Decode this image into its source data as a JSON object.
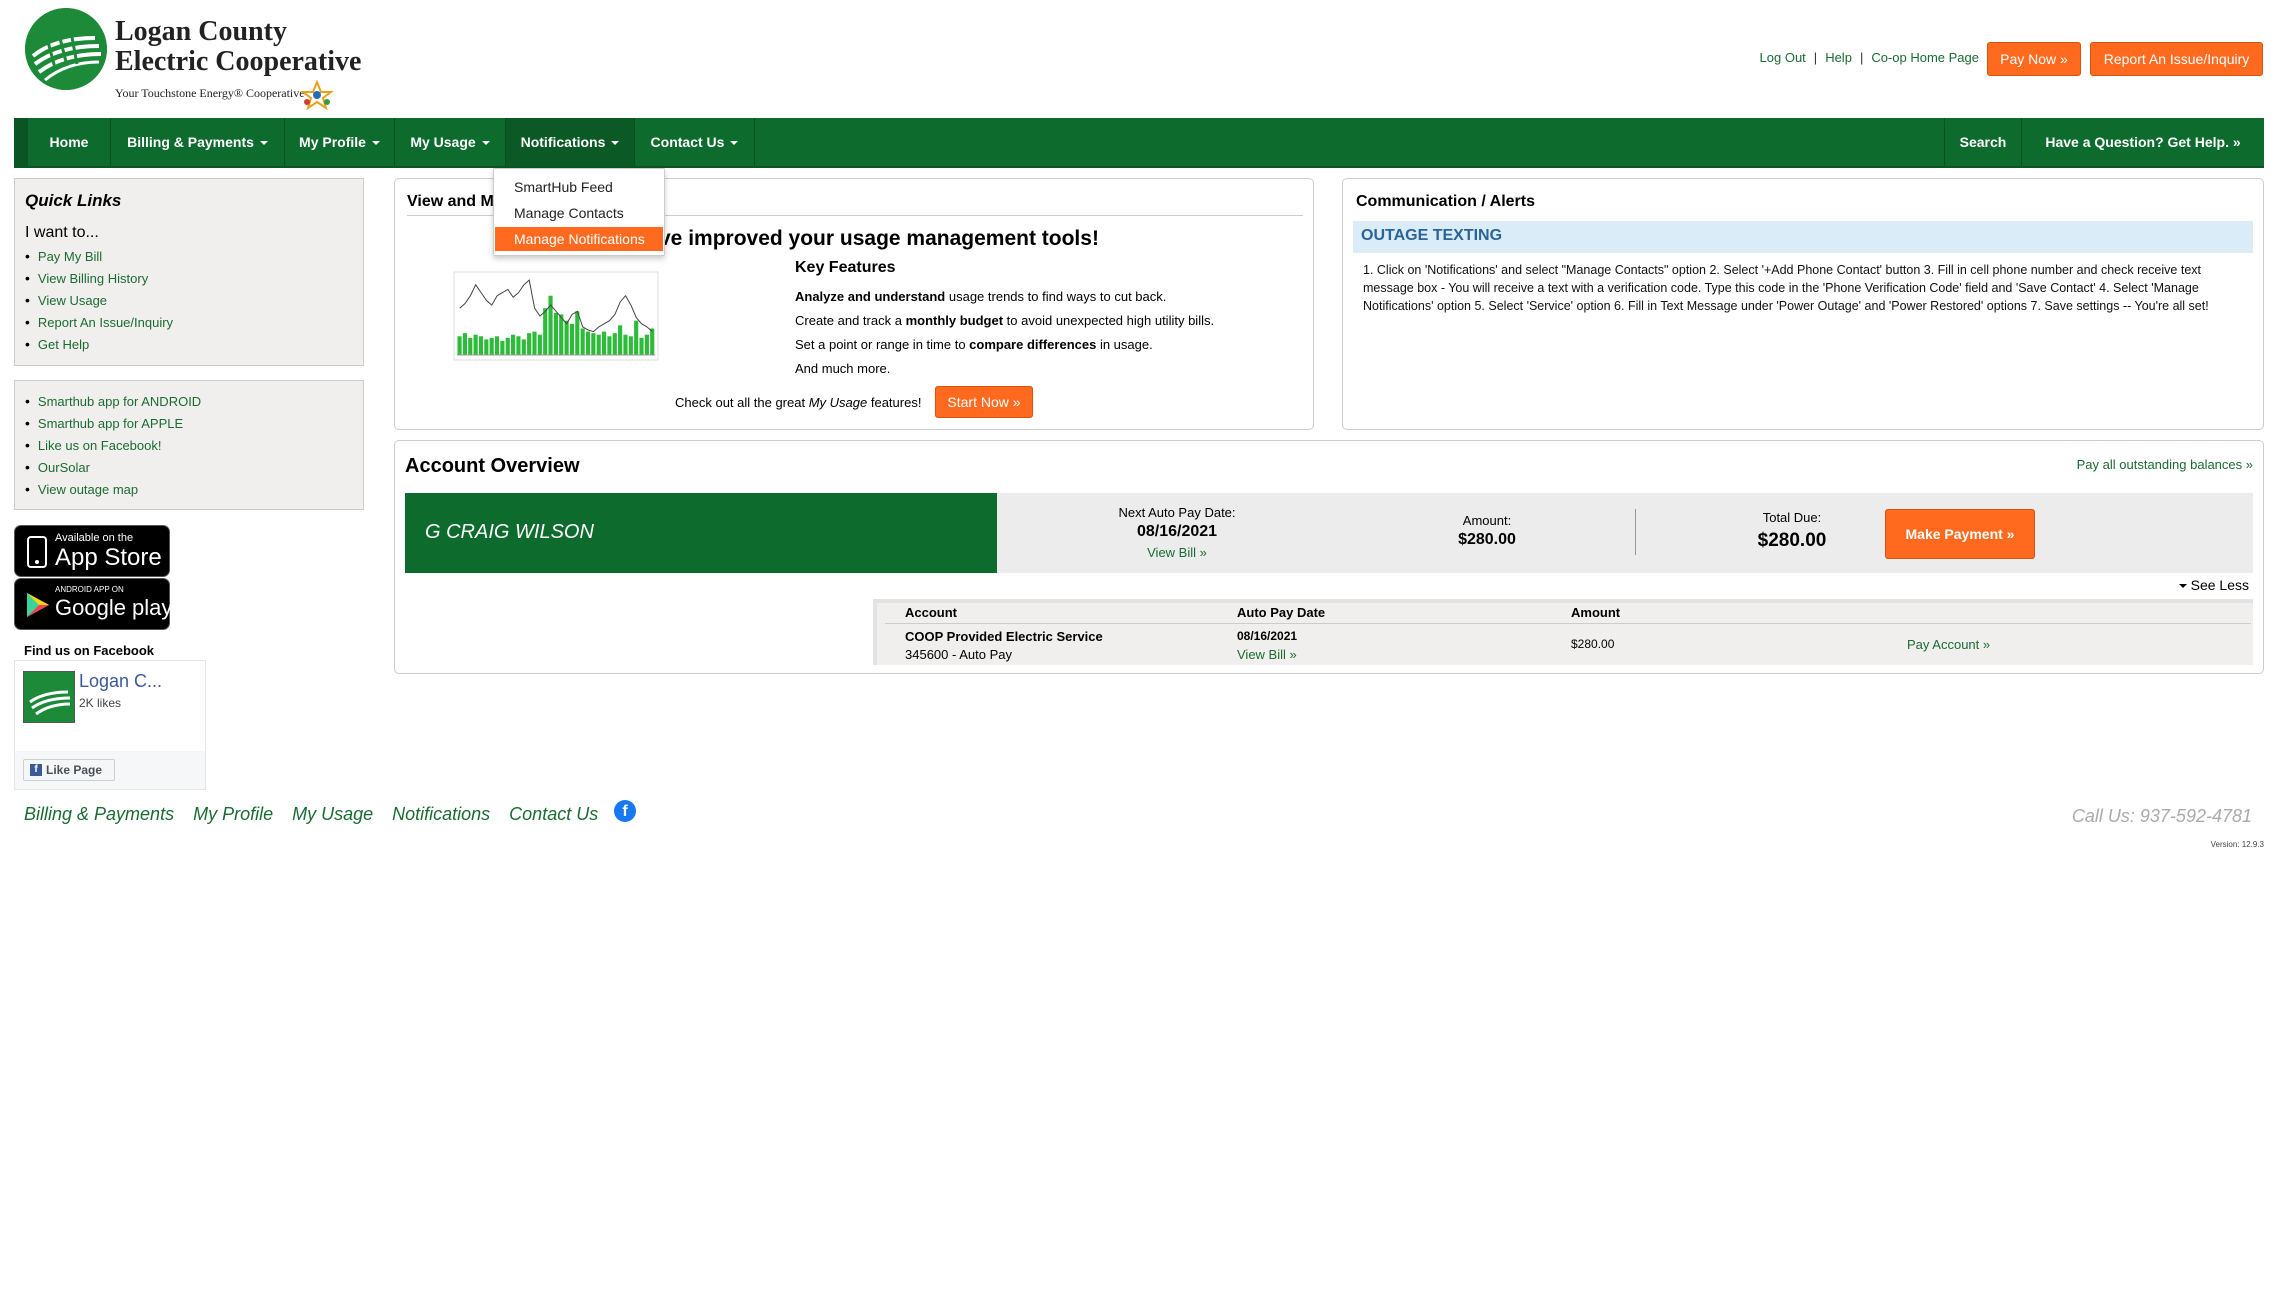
{
  "brand": {
    "name_line1": "Logan County",
    "name_line2": "Electric Cooperative",
    "tagline": "Your Touchstone Energy® Cooperative"
  },
  "header": {
    "links": [
      "Log Out",
      "Help",
      "Co-op Home Page"
    ],
    "pay_now": "Pay Now »",
    "report_issue": "Report An Issue/Inquiry"
  },
  "nav": {
    "items": [
      "Home",
      "Billing & Payments",
      "My Profile",
      "My Usage",
      "Notifications",
      "Contact Us"
    ],
    "search": "Search",
    "help": "Have a Question? Get Help. »"
  },
  "dropdown": {
    "items": [
      "SmartHub Feed",
      "Manage Contacts",
      "Manage Notifications"
    ],
    "selected": "Manage Notifications"
  },
  "quick_links": {
    "title": "Quick Links",
    "subtitle": "I want to...",
    "items": [
      "Pay My Bill",
      "View Billing History",
      "View Usage",
      "Report An Issue/Inquiry",
      "Get Help"
    ]
  },
  "app_links": {
    "items": [
      "Smarthub app for ANDROID",
      "Smarthub app for APPLE",
      "Like us on Facebook!",
      "OurSolar",
      "View outage map"
    ]
  },
  "badges": {
    "apple_small": "Available on the",
    "apple_big": "App Store",
    "google_small": "ANDROID APP ON",
    "google_big": "Google play"
  },
  "facebook": {
    "heading": "Find us on Facebook",
    "page_name": "Logan C...",
    "likes": "2K likes",
    "like_button": "Like Page"
  },
  "usage_panel": {
    "title": "View and M",
    "headline": "ve improved your usage management tools!",
    "key_features": "Key Features",
    "features": [
      {
        "bold": "Analyze and understand",
        "rest": " usage trends to find ways to cut back."
      },
      {
        "pre": "Create and track a ",
        "bold": "monthly budget",
        "rest": " to avoid unexpected high utility bills."
      },
      {
        "pre": "Set a point or range in time to ",
        "bold": "compare differences",
        "rest": " in usage."
      },
      {
        "pre": "And much more.",
        "bold": "",
        "rest": ""
      }
    ],
    "checkout_pre": "Check out all the great ",
    "checkout_em": "My Usage",
    "checkout_post": " features!",
    "start_now": "Start Now »"
  },
  "alerts": {
    "title": "Communication / Alerts",
    "subtitle": "OUTAGE TEXTING",
    "body": "1. Click on 'Notifications' and select \"Manage Contacts\" option 2. Select '+Add Phone Contact' button 3. Fill in cell phone number and check receive text message box - You will receive a text with a verification code. Type this code in the 'Phone Verification Code' field and 'Save Contact' 4. Select 'Manage Notifications' option 5. Select 'Service' option 6. Fill in Text Message under 'Power Outage' and 'Power Restored' options 7. Save settings -- You're all set!"
  },
  "account": {
    "title": "Account Overview",
    "pay_all": "Pay all outstanding balances »",
    "holder": "G CRAIG WILSON",
    "next_autopay_label": "Next Auto Pay Date:",
    "next_autopay_value": "08/16/2021",
    "view_bill": "View Bill »",
    "amount_label": "Amount:",
    "amount_value": "$280.00",
    "total_due_label": "Total Due:",
    "total_due_value": "$280.00",
    "make_payment": "Make Payment »",
    "see_less": "See Less",
    "table": {
      "headers": [
        "Account",
        "Auto Pay Date",
        "Amount"
      ],
      "rows": [
        {
          "account": "COOP Provided Electric Service",
          "account_sub": "345600 - Auto Pay",
          "date": "08/16/2021",
          "date_link": "View Bill »",
          "amount": "$280.00",
          "action": "Pay Account »"
        }
      ]
    }
  },
  "footer": {
    "links": [
      "Billing & Payments",
      "My Profile",
      "My Usage",
      "Notifications",
      "Contact Us"
    ],
    "phone": "Call Us: 937-592-4781",
    "version": "Version: 12.9.3"
  },
  "colors": {
    "brand_green": "#0d6b2d",
    "accent_orange": "#ff6a1f",
    "link_green": "#1a6b32",
    "alert_blue": "#2a6496"
  },
  "chart_data": {
    "type": "bar",
    "values": [
      12,
      14,
      11,
      13,
      12,
      10,
      11,
      12,
      9,
      11,
      13,
      12,
      10,
      14,
      15,
      13,
      30,
      38,
      27,
      26,
      22,
      20,
      28,
      17,
      15,
      14,
      13,
      15,
      12,
      14,
      19,
      13,
      12,
      22,
      11,
      13,
      17
    ],
    "line": [
      30,
      33,
      38,
      45,
      40,
      35,
      32,
      38,
      40,
      42,
      37,
      40,
      45,
      48,
      30,
      25,
      28,
      32,
      28,
      24,
      20,
      26,
      28,
      18,
      16,
      15,
      18,
      20,
      22,
      26,
      34,
      38,
      32,
      24,
      20,
      18,
      15
    ]
  }
}
